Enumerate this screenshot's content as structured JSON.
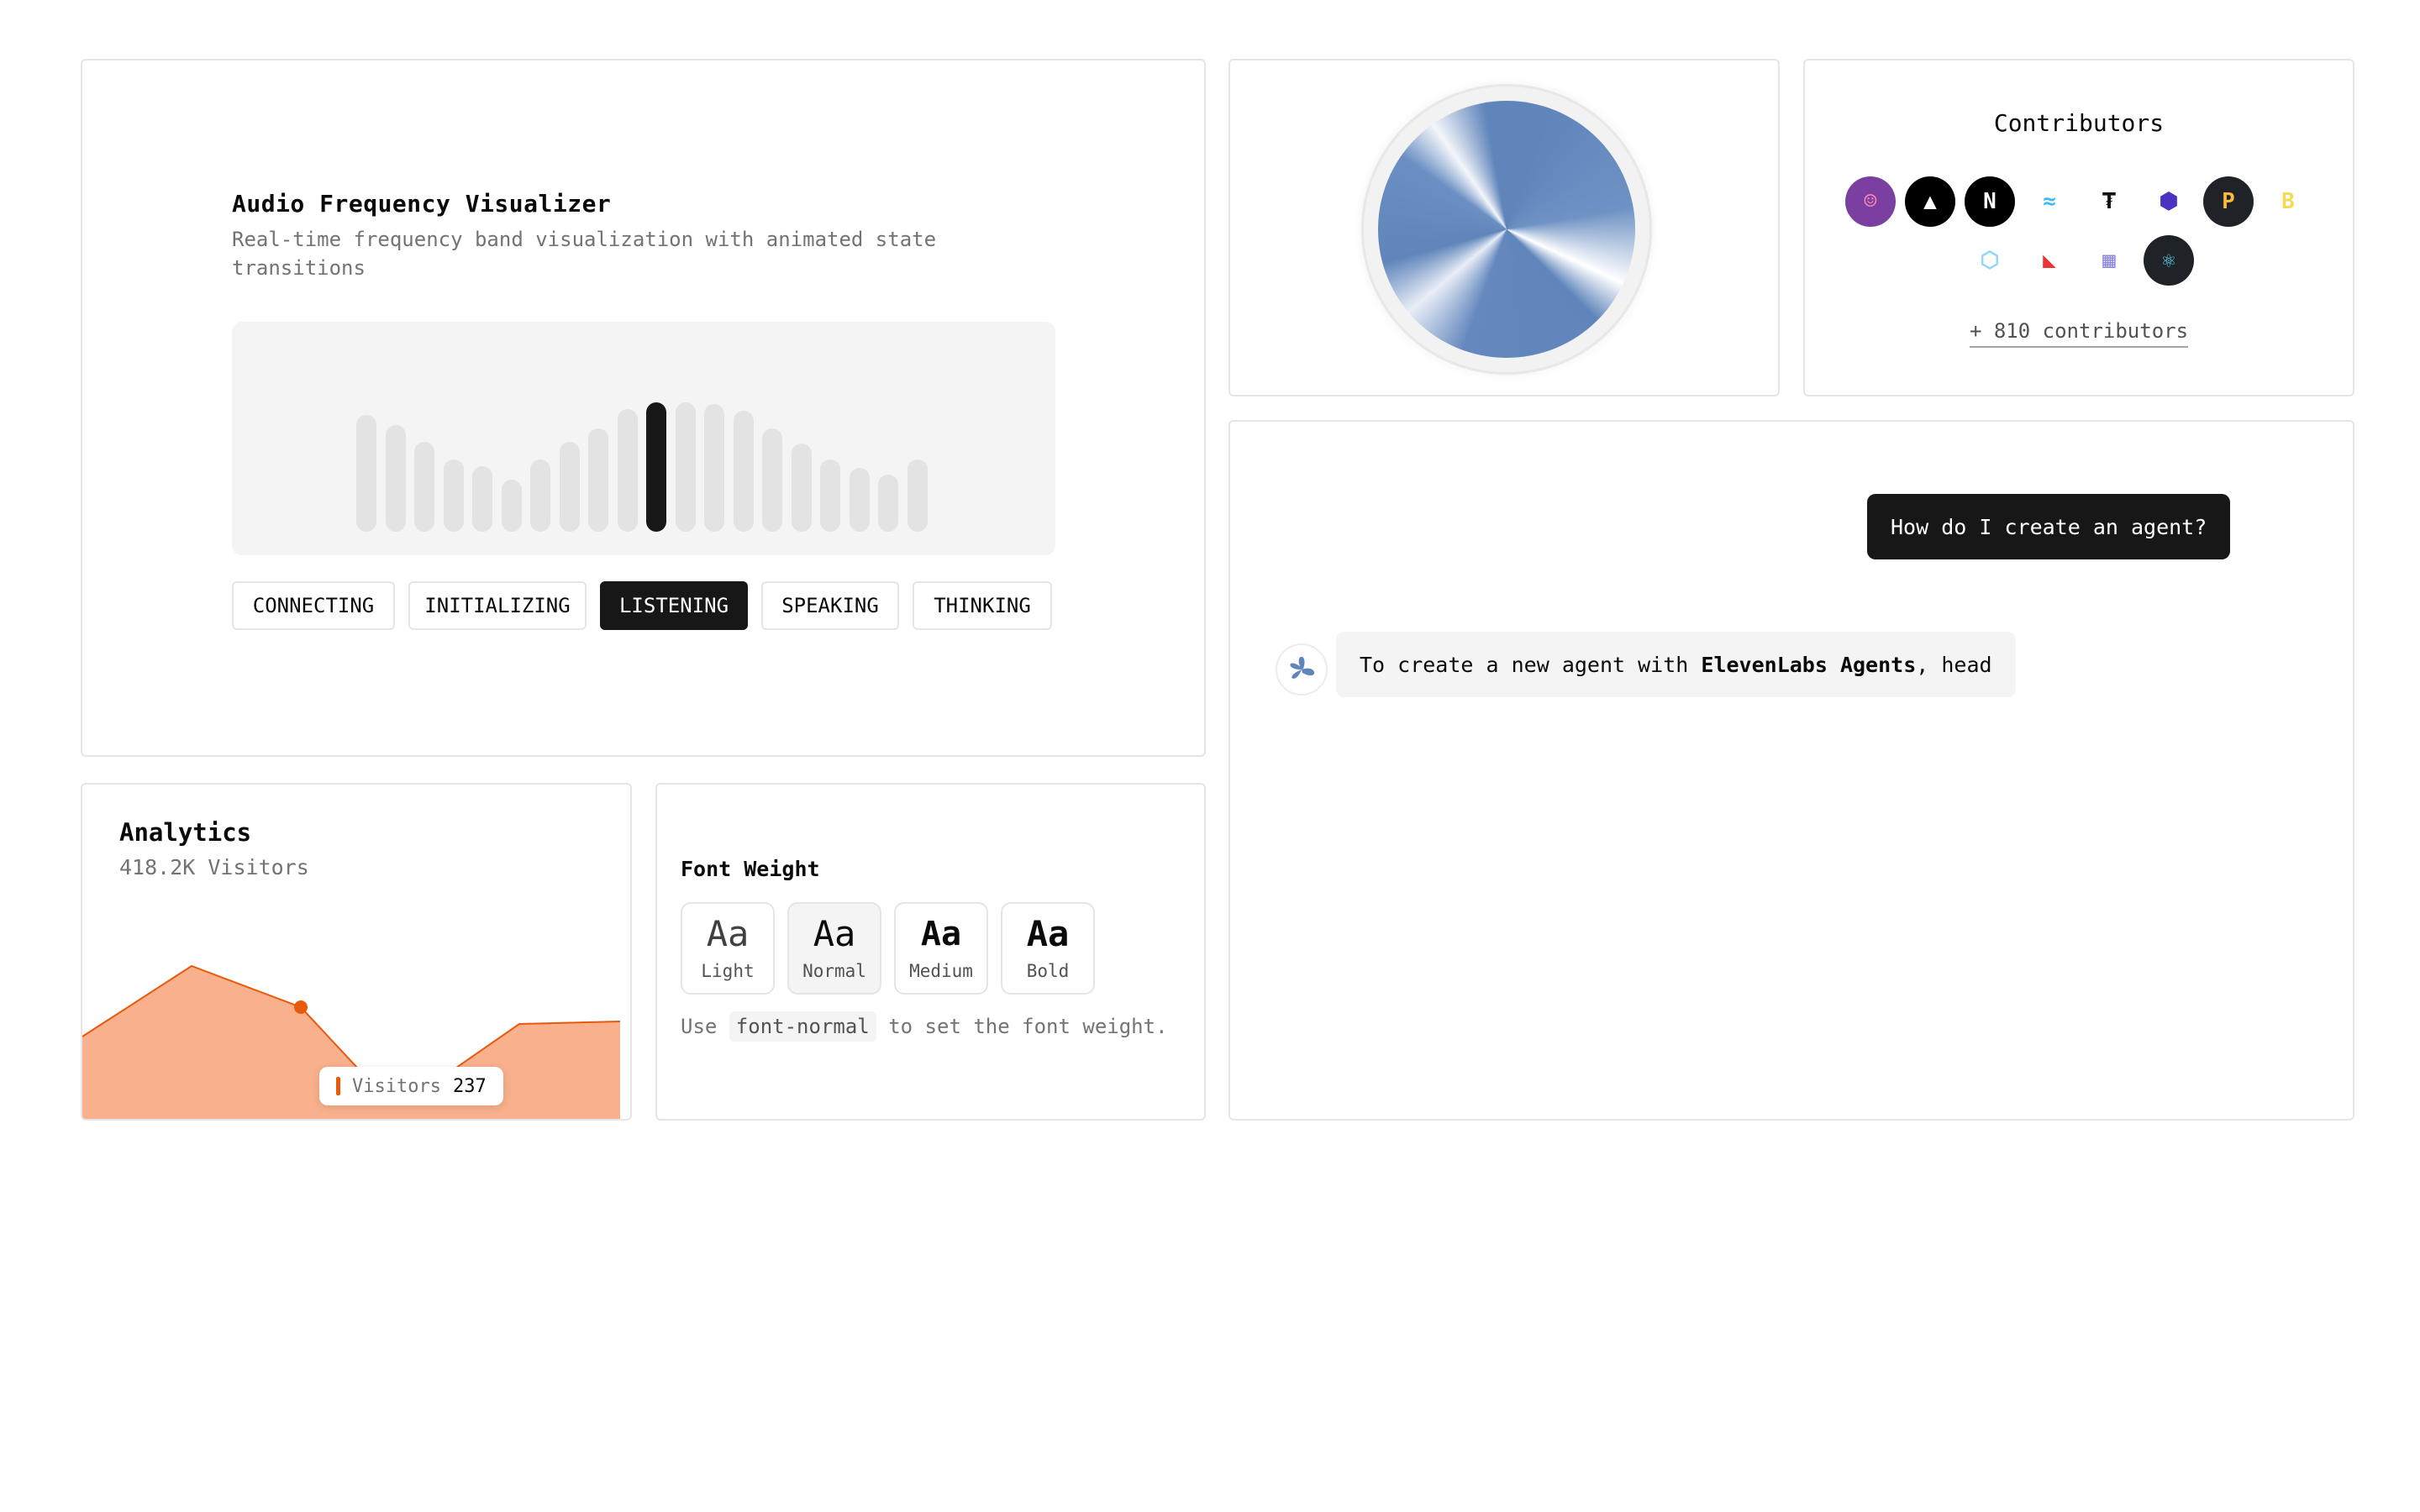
{
  "audio_visualizer": {
    "title": "Audio Frequency Visualizer",
    "description": "Real-time frequency band visualization with animated state transitions",
    "bands": [
      0.68,
      0.62,
      0.52,
      0.42,
      0.38,
      0.3,
      0.42,
      0.52,
      0.6,
      0.71,
      0.75,
      0.75,
      0.74,
      0.7,
      0.6,
      0.51,
      0.42,
      0.37,
      0.33,
      0.42
    ],
    "active_band_index": 10,
    "states": [
      "CONNECTING",
      "INITIALIZING",
      "LISTENING",
      "SPEAKING",
      "THINKING"
    ],
    "active_state": "LISTENING"
  },
  "orb": {
    "icon": "orb-visual",
    "accent": "#5f85bb"
  },
  "contributors": {
    "title": "Contributors",
    "avatars": [
      {
        "name": "user-avatar-icon",
        "bg": "#7b3fa1",
        "fg": "#ff8ab3",
        "glyph": "☺"
      },
      {
        "name": "vercel-icon",
        "bg": "#000000",
        "fg": "#ffffff",
        "glyph": "▲"
      },
      {
        "name": "nextjs-icon",
        "bg": "#000000",
        "fg": "#ffffff",
        "glyph": "N"
      },
      {
        "name": "tailwind-icon",
        "bg": "#ffffff",
        "fg": "#38bdf8",
        "glyph": "≈"
      },
      {
        "name": "turborepo-icon",
        "bg": "#ffffff",
        "fg": "#111111",
        "glyph": "₮"
      },
      {
        "name": "eslint-icon",
        "bg": "#ffffff",
        "fg": "#4b32c3",
        "glyph": "⬢"
      },
      {
        "name": "prettier-icon",
        "bg": "#1f2328",
        "fg": "#f7b93e",
        "glyph": "P"
      },
      {
        "name": "babel-icon",
        "bg": "#ffffff",
        "fg": "#f5da55",
        "glyph": "B"
      },
      {
        "name": "webpack-icon",
        "bg": "#ffffff",
        "fg": "#8ed6fb",
        "glyph": "⬡"
      },
      {
        "name": "rollup-icon",
        "bg": "#ffffff",
        "fg": "#ef3335",
        "glyph": "◣"
      },
      {
        "name": "pattern-icon",
        "bg": "#ffffff",
        "fg": "#8f86e0",
        "glyph": "▦"
      },
      {
        "name": "react-icon",
        "bg": "#1f2328",
        "fg": "#61dafb",
        "glyph": "⚛"
      }
    ],
    "link": "+ 810 contributors"
  },
  "chat": {
    "user_message": "How do I create an agent?",
    "agent_message_prefix": "To create a new agent with ",
    "agent_message_bold": "ElevenLabs Agents",
    "agent_message_suffix": ", head"
  },
  "analytics": {
    "title": "Analytics",
    "subtitle": "418.2K Visitors",
    "tooltip_label": "Visitors",
    "tooltip_value": "237",
    "accent": "#e8590c",
    "fill": "#f9b08c"
  },
  "font_weight": {
    "title": "Font Weight",
    "options": [
      {
        "sample": "Aa",
        "label": "Light",
        "weight": 300
      },
      {
        "sample": "Aa",
        "label": "Normal",
        "weight": 400
      },
      {
        "sample": "Aa",
        "label": "Medium",
        "weight": 500
      },
      {
        "sample": "Aa",
        "label": "Bold",
        "weight": 700
      }
    ],
    "selected": "Normal",
    "note_prefix": "Use ",
    "note_code": "font-normal",
    "note_suffix": " to set the font weight."
  }
}
